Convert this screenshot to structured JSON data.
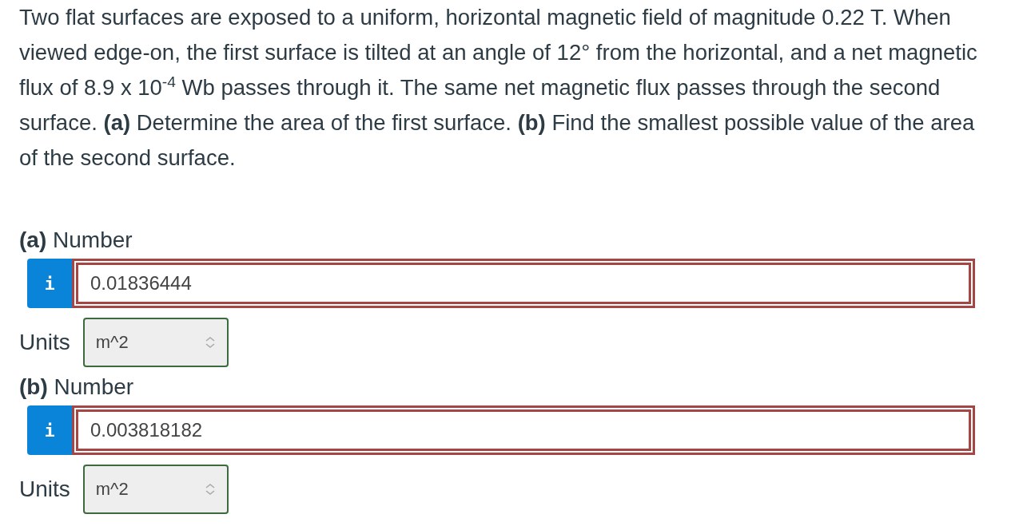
{
  "question": "Two flat surfaces are exposed to a uniform, horizontal magnetic field of magnitude 0.22 T. When viewed edge-on, the first surface is tilted at an angle of 12° from the horizontal, and a net magnetic flux of 8.9 x 10$^{-4}$ Wb passes through it. The same net magnetic flux passes through the second surface. **(a)** Determine the area of the first surface. **(b)** Find the smallest possible value of the area of the second surface.",
  "parts": [
    {
      "label": "(a)",
      "field_label": "Number",
      "info": "i",
      "value": "0.01836444",
      "correct": false,
      "units_label": "Units",
      "units": "m^2",
      "units_correct": true
    },
    {
      "label": "(b)",
      "field_label": "Number",
      "info": "i",
      "value": "0.003818182",
      "correct": false,
      "units_label": "Units",
      "units": "m^2",
      "units_correct": true
    }
  ]
}
